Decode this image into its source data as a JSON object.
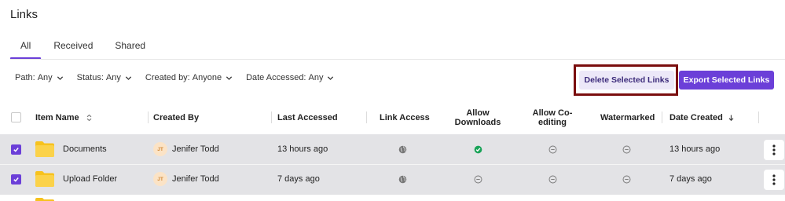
{
  "page": {
    "title": "Links"
  },
  "tabs": [
    {
      "label": "All",
      "active": true
    },
    {
      "label": "Received",
      "active": false
    },
    {
      "label": "Shared",
      "active": false
    }
  ],
  "filters": [
    {
      "label": "Path:",
      "value": "Any"
    },
    {
      "label": "Status:",
      "value": "Any"
    },
    {
      "label": "Created by:",
      "value": "Anyone"
    },
    {
      "label": "Date Accessed:",
      "value": "Any"
    }
  ],
  "actions": {
    "delete_label": "Delete Selected Links",
    "export_label": "Export Selected Links"
  },
  "columns": {
    "item_name": "Item Name",
    "created_by": "Created By",
    "last_accessed": "Last Accessed",
    "link_access": "Link Access",
    "allow_downloads_1": "Allow",
    "allow_downloads_2": "Downloads",
    "allow_coediting_1": "Allow Co-",
    "allow_coediting_2": "editing",
    "watermarked": "Watermarked",
    "date_created": "Date Created"
  },
  "rows": [
    {
      "name": "Documents",
      "creator_initials": "JT",
      "creator": "Jenifer Todd",
      "last_accessed": "13 hours ago",
      "link_access": "globe-icon",
      "allow_downloads": "check-circle-icon",
      "allow_coediting": "minus-circle-icon",
      "watermarked": "minus-circle-icon",
      "date_created": "13 hours ago",
      "selected": true
    },
    {
      "name": "Upload Folder",
      "creator_initials": "JT",
      "creator": "Jenifer Todd",
      "last_accessed": "7 days ago",
      "link_access": "globe-icon",
      "allow_downloads": "minus-circle-icon",
      "allow_coediting": "minus-circle-icon",
      "watermarked": "minus-circle-icon",
      "date_created": "7 days ago",
      "selected": true
    }
  ],
  "colors": {
    "accent": "#6b3fd8",
    "delete_bg": "#ece8f8",
    "row_selected_bg": "#e3e3e6",
    "success": "#1aa358",
    "highlight_frame": "#7a0e0e",
    "folder": "#f7c21d"
  }
}
